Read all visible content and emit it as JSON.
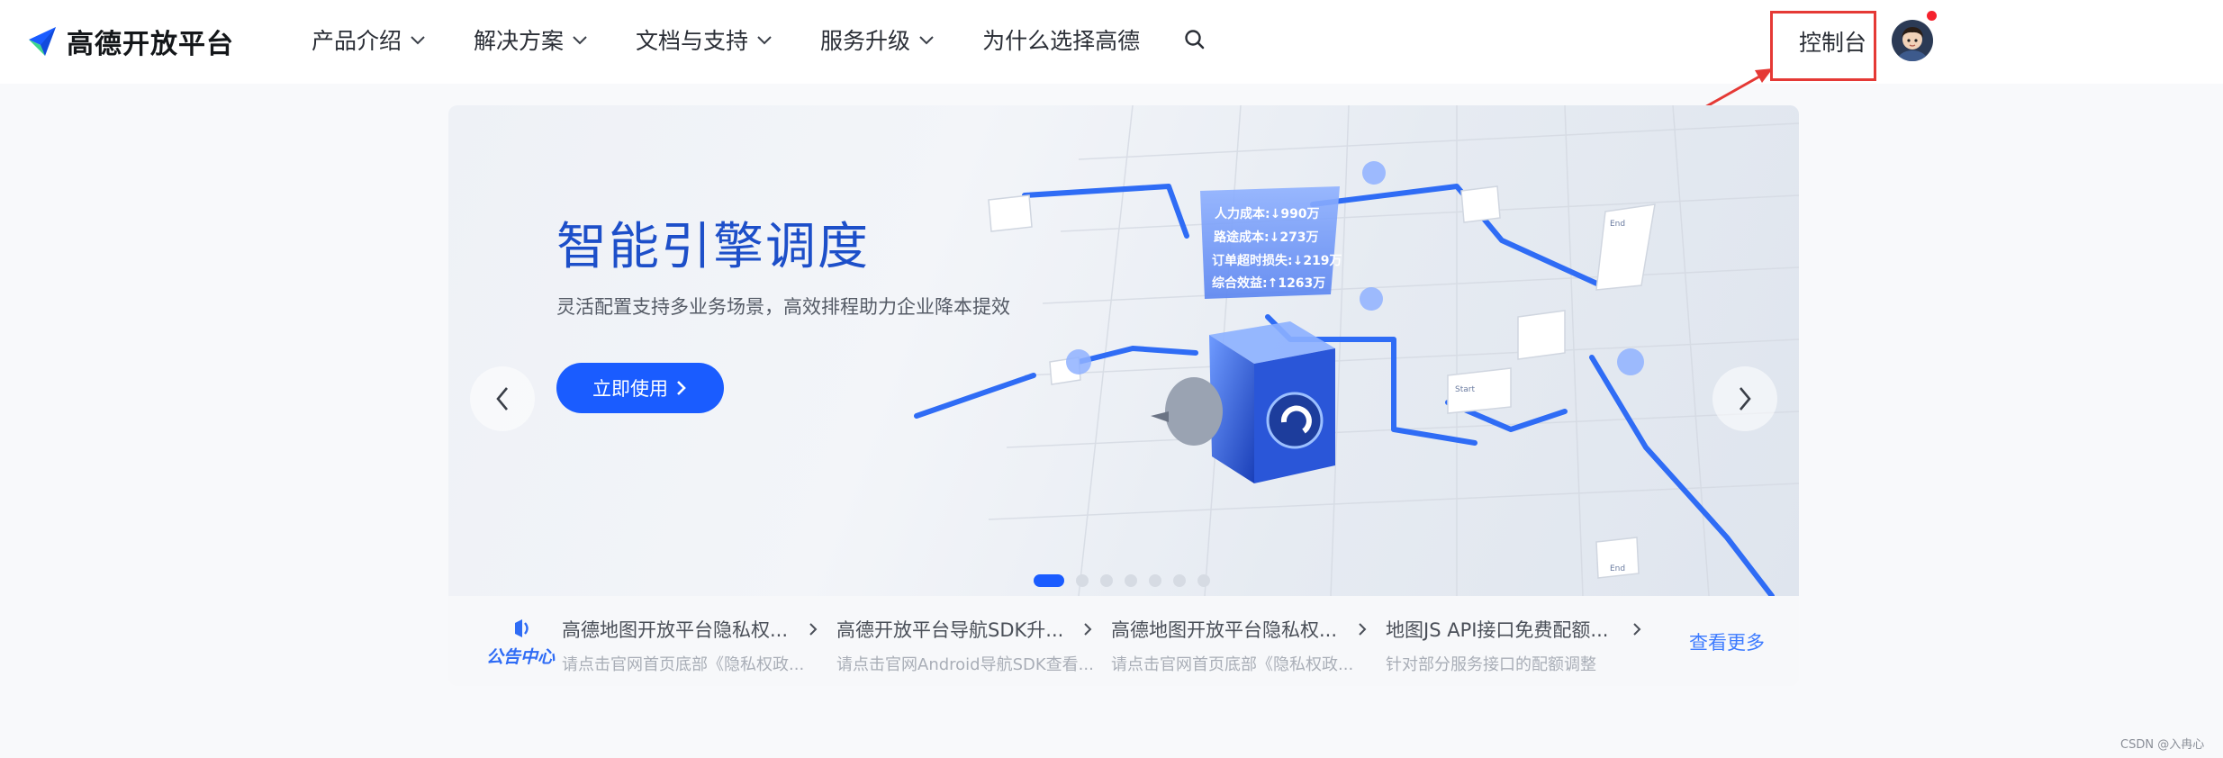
{
  "brand": {
    "name": "高德开放平台"
  },
  "nav": {
    "items": [
      {
        "label": "产品介绍",
        "has_dropdown": true
      },
      {
        "label": "解决方案",
        "has_dropdown": true
      },
      {
        "label": "文档与支持",
        "has_dropdown": true
      },
      {
        "label": "服务升级",
        "has_dropdown": true
      },
      {
        "label": "为什么选择高德",
        "has_dropdown": false
      }
    ],
    "search_icon": "search-icon"
  },
  "user": {
    "console_label": "控制台",
    "has_notification": true
  },
  "colors": {
    "accent": "#1a5cff",
    "highlight_box": "#e53935",
    "title_blue": "#1d4fc9"
  },
  "banner": {
    "title": "智能引擎调度",
    "subtitle": "灵活配置支持多业务场景，高效排程助力企业降本提效",
    "cta_label": "立即使用",
    "panel_lines": [
      "人力成本:↓990万",
      "路途成本:↓273万",
      "订单超时损失:↓219万",
      "综合效益:↑1263万"
    ],
    "tags": {
      "start": "Start",
      "end": "End"
    },
    "slides_total": 7,
    "active_slide": 1
  },
  "notice": {
    "section_label": "公告中心",
    "items": [
      {
        "title": "高德地图开放平台隐私权...",
        "desc": "请点击官网首页底部《隐私权政..."
      },
      {
        "title": "高德开放平台导航SDK升...",
        "desc": "请点击官网Android导航SDK查看..."
      },
      {
        "title": "高德地图开放平台隐私权...",
        "desc": "请点击官网首页底部《隐私权政..."
      },
      {
        "title": "地图JS API接口免费配额...",
        "desc": "针对部分服务接口的配额调整"
      }
    ],
    "more_label": "查看更多"
  },
  "watermark": "CSDN @入冉心"
}
